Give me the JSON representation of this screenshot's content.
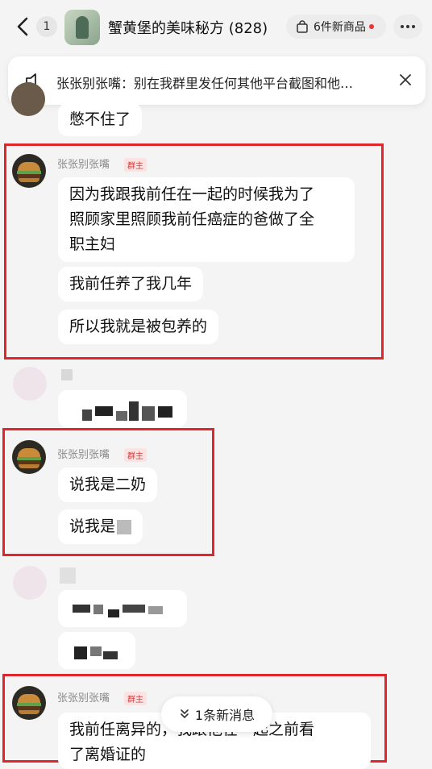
{
  "header": {
    "unread_count": "1",
    "group_title": "蟹黄堡的美味秘方 (828)",
    "shop_label": "6件新商品"
  },
  "notice": {
    "text": "张张别张嘴：别在我群里发任何其他平台截图和他…"
  },
  "messages": {
    "top_partial": "憋不住了",
    "block1": {
      "sender": "张张别张嘴",
      "role": "群主",
      "lines": [
        "因为我跟我前任在一起的时候我为了",
        "照顾家里照顾我前任癌症的爸做了全",
        "职主妇"
      ],
      "msg2": "我前任养了我几年",
      "msg3": "所以我就是被包养的"
    },
    "block2": {
      "sender": "张张别张嘴",
      "role": "群主",
      "msg1": "说我是二奶",
      "msg2": "说我是"
    },
    "block3": {
      "sender": "张张别张嘴",
      "role": "群主",
      "line1": "我前任离异的，我跟他在一起之前看",
      "line2": "了离婚证的"
    }
  },
  "new_message_pill": "1条新消息",
  "colors": {
    "highlight_border": "#e0262c",
    "role_text": "#d23d3d",
    "background": "#f4f4f4"
  }
}
